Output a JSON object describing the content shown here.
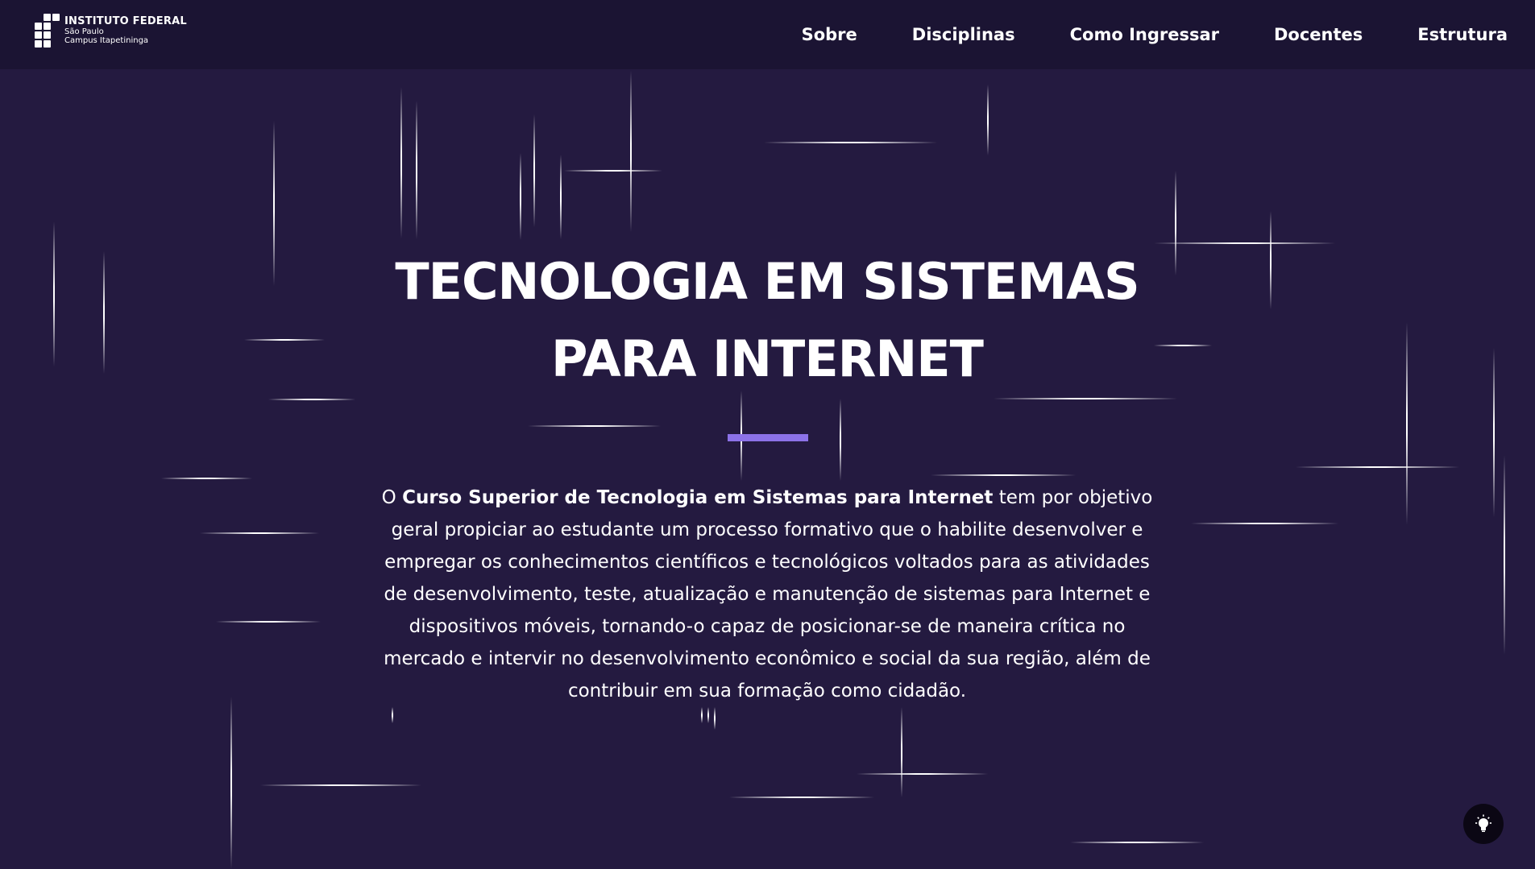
{
  "header": {
    "logo": {
      "title": "INSTITUTO FEDERAL",
      "line1": "São Paulo",
      "line2": "Campus Itapetininga"
    },
    "nav": [
      {
        "label": "Sobre"
      },
      {
        "label": "Disciplinas"
      },
      {
        "label": "Como Ingressar"
      },
      {
        "label": "Docentes"
      },
      {
        "label": "Estrutura"
      }
    ]
  },
  "hero": {
    "title_line1": "TECNOLOGIA EM SISTEMAS",
    "title_line2": "PARA INTERNET",
    "description_prefix": "O ",
    "description_bold": "Curso Superior de Tecnologia em Sistemas para Internet",
    "description_rest": " tem por objetivo geral propiciar ao estudante um processo formativo que o habilite desenvolver e empregar os conhecimentos científicos e tecnológicos voltados para as atividades de desenvolvimento, teste, atualização e manutenção de sistemas para Internet e dispositivos móveis, tornando-o capaz de posicionar-se de maneira crítica no mercado e intervir no desenvolvimento econômico e social da sua região, além de contribuir em sua formação como cidadão."
  },
  "theme_toggle": {
    "icon": "lightbulb-icon"
  },
  "colors": {
    "background": "#241a40",
    "header_background": "#1b1433",
    "accent": "#8c72e8",
    "text": "#ffffff",
    "toggle_background": "#0b0714"
  }
}
